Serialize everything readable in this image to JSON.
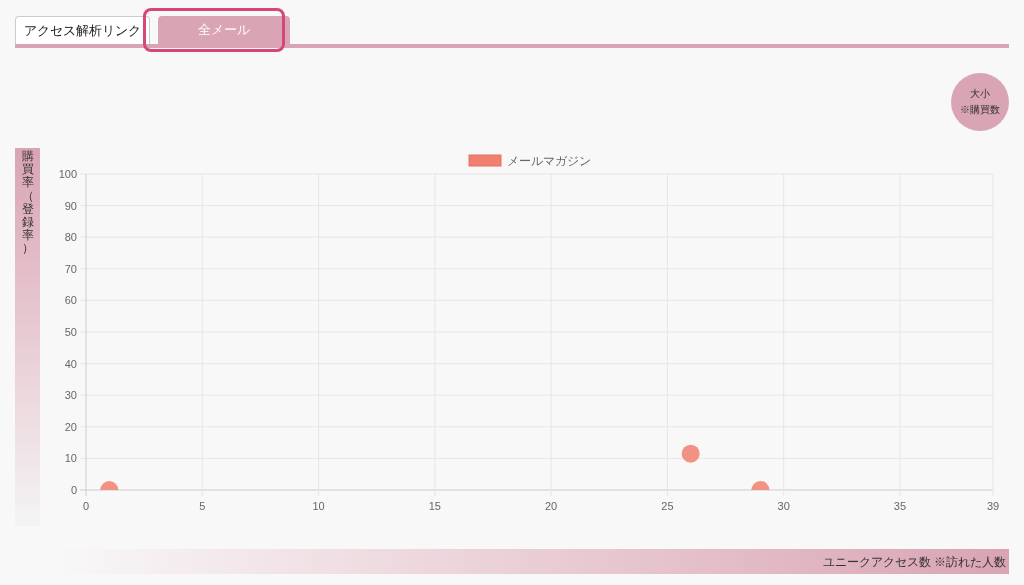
{
  "tabs": [
    {
      "label": "アクセス解析リンク",
      "selected": false
    },
    {
      "label": "全メール",
      "selected": true
    }
  ],
  "size_badge": {
    "line_1": "大小",
    "line_2": "※購買数"
  },
  "y_axis_band": {
    "label": "購買率（登録率）"
  },
  "chart": {
    "chart_data": {
      "type": "scatter",
      "x": [
        1,
        26,
        29
      ],
      "series": [
        {
          "name": "メールマガジン",
          "color": "#f08070",
          "values": [
            0,
            11.5,
            0
          ]
        }
      ],
      "grid": true,
      "xlim": [
        0,
        39
      ],
      "ylim": [
        0,
        100
      ],
      "xticks": [
        0,
        5,
        10,
        15,
        20,
        25,
        30,
        35,
        39
      ],
      "yticks": [
        0,
        10,
        20,
        30,
        40,
        50,
        60,
        70,
        80,
        90,
        100
      ]
    }
  },
  "x_axis_band": {
    "label": "ユニークアクセス数 ※訪れた人数"
  }
}
